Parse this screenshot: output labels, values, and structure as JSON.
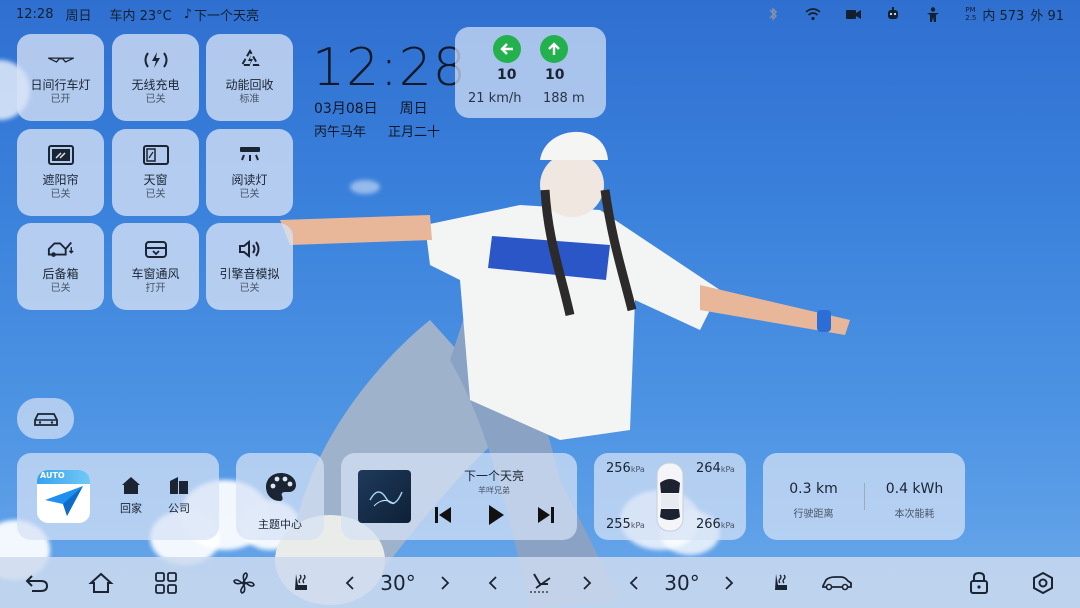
{
  "status_bar": {
    "time": "12:28",
    "weekday": "周日",
    "cabin_temp": "车内 23°C",
    "now_playing": "下一个天亮",
    "pm_label_top": "PM",
    "pm_label_bottom": "2.5",
    "pm_inside": "内 573",
    "pm_outside": "外 91"
  },
  "tiles": [
    {
      "label": "日间行车灯",
      "state": "已开",
      "icon": "daytime-running-lights-icon"
    },
    {
      "label": "无线充电",
      "state": "已关",
      "icon": "wireless-charging-icon"
    },
    {
      "label": "动能回收",
      "state": "标准",
      "icon": "energy-recovery-icon"
    },
    {
      "label": "遮阳帘",
      "state": "已关",
      "icon": "sunshade-icon"
    },
    {
      "label": "天窗",
      "state": "已关",
      "icon": "sunroof-icon"
    },
    {
      "label": "阅读灯",
      "state": "已关",
      "icon": "reading-light-icon"
    },
    {
      "label": "后备箱",
      "state": "已关",
      "icon": "trunk-icon"
    },
    {
      "label": "车窗通风",
      "state": "打开",
      "icon": "window-vent-icon"
    },
    {
      "label": "引擎音模拟",
      "state": "已关",
      "icon": "engine-sound-icon"
    }
  ],
  "clock": {
    "time": "12:28",
    "date": "03月08日",
    "weekday": "周日",
    "lunar_year": "丙午马年",
    "lunar_day": "正月二十"
  },
  "navigation": {
    "left_value": "10",
    "up_value": "10",
    "speed": "21 km/h",
    "distance": "188 m"
  },
  "apps": {
    "home": "回家",
    "company": "公司",
    "theme": "主题中心",
    "nav_app_badge": "AUTO"
  },
  "music": {
    "title": "下一个天亮",
    "artist": "羊咩兄弟"
  },
  "tires": {
    "front_left": "256",
    "front_right": "264",
    "rear_left": "255",
    "rear_right": "266",
    "unit": "kPa"
  },
  "trip": {
    "distance_value": "0.3 km",
    "distance_label": "行驶距离",
    "energy_value": "0.4 kWh",
    "energy_label": "本次能耗"
  },
  "dock": {
    "left_temp": "30°",
    "right_temp": "30°"
  },
  "colors": {
    "accent_green": "#22b14c",
    "card_bg": "#d6e2f5"
  }
}
